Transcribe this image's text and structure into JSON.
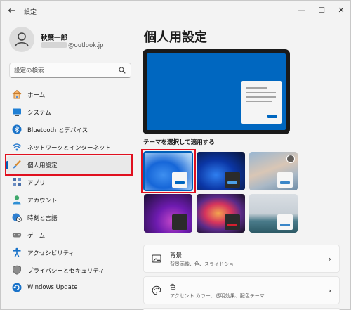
{
  "window": {
    "title": "設定"
  },
  "titlebar": {
    "back": "←",
    "minimize": "—",
    "maximize": "☐",
    "close": "✕"
  },
  "profile": {
    "name": "秋葉一郎",
    "email_suffix": "@outlook.jp"
  },
  "search": {
    "placeholder": "設定の検索"
  },
  "nav": {
    "items": [
      {
        "label": "ホーム",
        "icon": "home-icon"
      },
      {
        "label": "システム",
        "icon": "system-icon"
      },
      {
        "label": "Bluetooth とデバイス",
        "icon": "bluetooth-icon"
      },
      {
        "label": "ネットワークとインターネット",
        "icon": "wifi-icon"
      },
      {
        "label": "個人用設定",
        "icon": "brush-icon",
        "selected": true
      },
      {
        "label": "アプリ",
        "icon": "apps-icon"
      },
      {
        "label": "アカウント",
        "icon": "account-icon"
      },
      {
        "label": "時刻と言語",
        "icon": "clock-globe-icon"
      },
      {
        "label": "ゲーム",
        "icon": "gamepad-icon"
      },
      {
        "label": "アクセシビリティ",
        "icon": "accessibility-icon"
      },
      {
        "label": "プライバシーとセキュリティ",
        "icon": "shield-icon"
      },
      {
        "label": "Windows Update",
        "icon": "update-icon"
      }
    ]
  },
  "main": {
    "title": "個人用設定",
    "themes_label": "テーマを選択して適用する",
    "cards": [
      {
        "title": "背景",
        "subtitle": "背景画像、色、スライドショー",
        "icon": "image-icon"
      },
      {
        "title": "色",
        "subtitle": "アクセント カラー、透明効果、配色テーマ",
        "icon": "palette-icon"
      }
    ]
  },
  "colors": {
    "accent": "#005fb8",
    "highlight": "#e0101f"
  }
}
